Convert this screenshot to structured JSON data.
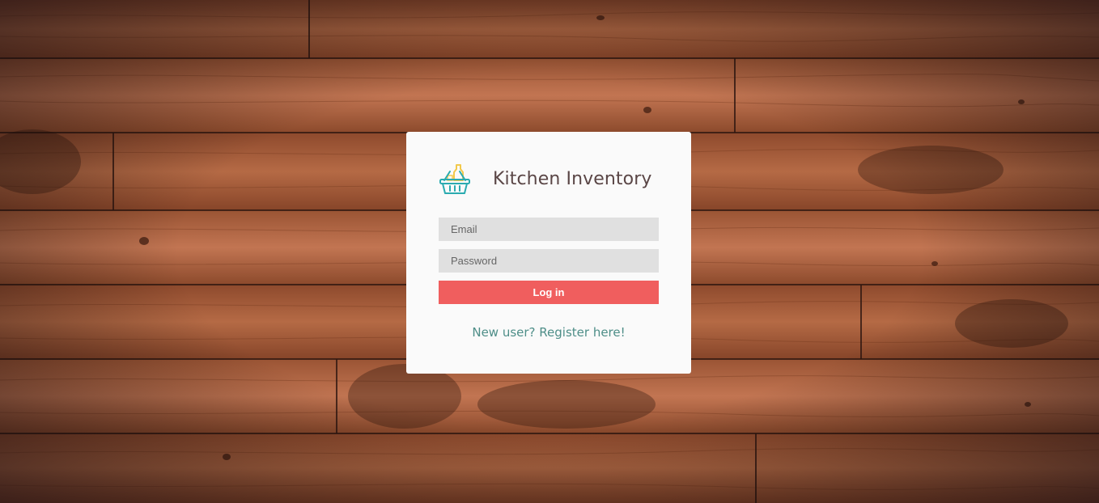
{
  "app": {
    "title": "Kitchen Inventory",
    "logo_icon": "basket-icon"
  },
  "login_form": {
    "email_placeholder": "Email",
    "email_value": "",
    "password_placeholder": "Password",
    "password_value": "",
    "submit_label": "Log in",
    "register_link_label": "New user? Register here!"
  },
  "colors": {
    "card_background": "#fafafa",
    "input_background": "#e0e0e0",
    "button_accent": "#f05e5e",
    "link_color": "#4e8e88",
    "title_color": "#5a4646",
    "logo_teal": "#2aabb0",
    "logo_yellow": "#f2c94c",
    "background_wood": "#a75f3c"
  },
  "background": {
    "type": "wooden-planks"
  }
}
